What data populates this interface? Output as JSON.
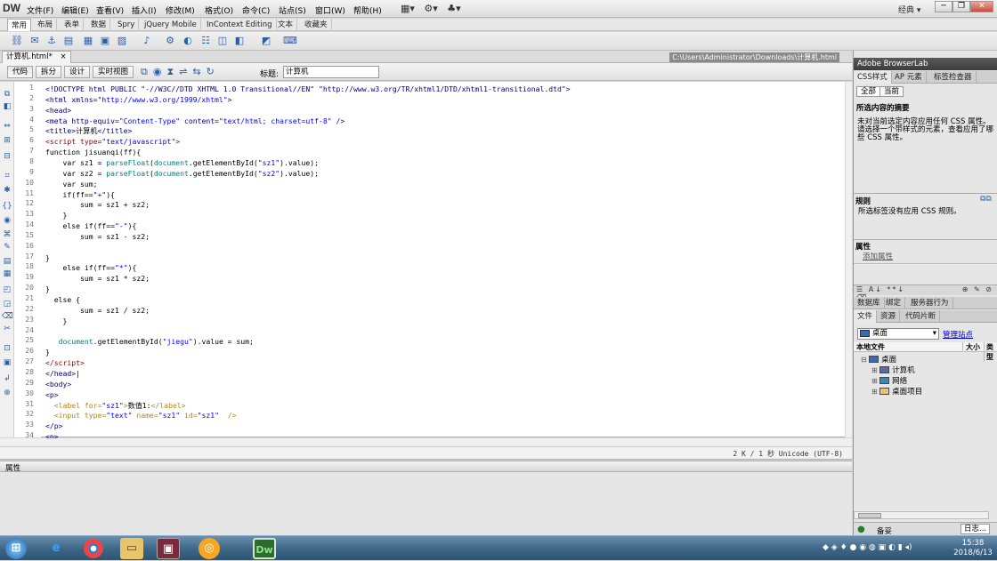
{
  "app": {
    "logo": "DW",
    "menu": [
      "文件(F)",
      "编辑(E)",
      "查看(V)",
      "插入(I)",
      "修改(M)",
      "格式(O)",
      "命令(C)",
      "站点(S)",
      "窗口(W)",
      "帮助(H)"
    ],
    "workspace": "经典",
    "window_buttons": [
      "─",
      "❐",
      "✕"
    ]
  },
  "insert_tabs": [
    "常用",
    "布局",
    "表单",
    "数据",
    "Spry",
    "jQuery Mobile",
    "InContext Editing",
    "文本",
    "收藏夹"
  ],
  "insert_icons": [
    "link-icon",
    "email-icon",
    "anchor-icon",
    "hr-icon",
    "table-icon",
    "div-icon",
    "image-icon",
    "media-icon",
    "date-icon",
    "server-icon",
    "comment-icon",
    "head-icon",
    "script-icon",
    "template-icon",
    "tag-chooser-icon"
  ],
  "document": {
    "tab": "计算机.html*",
    "close_glyph": "×",
    "path": "C:\\Users\\Administrator\\Downloads\\计算机.html"
  },
  "doc_toolbar": {
    "buttons": [
      "代码",
      "拆分",
      "设计",
      "实时视图"
    ],
    "title_label": "标题:",
    "title_value": "计算机"
  },
  "code_lines": [
    {
      "n": "1",
      "html": "<span class=\"tag\">&lt;!DOCTYPE html PUBLIC \"-//W3C//DTD XHTML 1.0 Transitional//EN\" \"http://www.w3.org/TR/xhtml1/DTD/xhtml1-transitional.dtd\"&gt;</span>"
    },
    {
      "n": "2",
      "html": "<span class=\"tag\">&lt;html xmlns=</span><span class=\"str\">\"http://www.w3.org/1999/xhtml\"</span><span class=\"tag\">&gt;</span>"
    },
    {
      "n": "3",
      "html": "<span class=\"tag\">&lt;head&gt;</span>"
    },
    {
      "n": "4",
      "html": "<span class=\"tag\">&lt;meta http-equiv=</span><span class=\"str\">\"Content-Type\"</span><span class=\"tag\"> content=</span><span class=\"str\">\"text/html; charset=utf-8\"</span><span class=\"tag\"> /&gt;</span>"
    },
    {
      "n": "5",
      "html": "<span class=\"tag\">&lt;title&gt;</span>计算机<span class=\"tag\">&lt;/title&gt;</span>"
    },
    {
      "n": "6",
      "html": "<span style=\"color:#8b0000\">&lt;script type=</span><span class=\"str\">\"text/javascript\"</span><span style=\"color:#8b0000\">&gt;</span>"
    },
    {
      "n": "7",
      "html": "function jisuanqi(ff){"
    },
    {
      "n": "8",
      "html": "    var sz1 = <span class=\"fn\">parseFloat</span>(<span class=\"fn\">document</span>.getElementById(<span class=\"str\">\"sz1\"</span>).value);"
    },
    {
      "n": "9",
      "html": "    var sz2 = <span class=\"fn\">parseFloat</span>(<span class=\"fn\">document</span>.getElementById(<span class=\"str\">\"sz2\"</span>).value);"
    },
    {
      "n": "10",
      "html": "    var sum;"
    },
    {
      "n": "11",
      "html": "    if(ff==<span class=\"str\">\"+\"</span>){"
    },
    {
      "n": "12",
      "html": "        sum = sz1 + sz2;"
    },
    {
      "n": "13",
      "html": "    }"
    },
    {
      "n": "14",
      "html": "    else if(ff==<span class=\"str\">\"-\"</span>){"
    },
    {
      "n": "15",
      "html": "        sum = sz1 - sz2;"
    },
    {
      "n": "16",
      "html": ""
    },
    {
      "n": "17",
      "html": "}"
    },
    {
      "n": "18",
      "html": "    else if(ff==<span class=\"str\">\"*\"</span>){"
    },
    {
      "n": "19",
      "html": "        sum = sz1 * sz2;"
    },
    {
      "n": "20",
      "html": "}"
    },
    {
      "n": "21",
      "html": "  else {"
    },
    {
      "n": "22",
      "html": "        sum = sz1 / sz2;"
    },
    {
      "n": "23",
      "html": "    }"
    },
    {
      "n": "24",
      "html": ""
    },
    {
      "n": "25",
      "html": "   <span class=\"fn\">document</span>.getElementById(<span class=\"str\">\"jiegu\"</span>).value = sum;"
    },
    {
      "n": "26",
      "html": "}"
    },
    {
      "n": "27",
      "html": "<span style=\"color:#8b0000\">&lt;/script&gt;</span>"
    },
    {
      "n": "28",
      "html": "<span class=\"tag\">&lt;/head&gt;</span>|"
    },
    {
      "n": "29",
      "html": "<span class=\"tag\">&lt;body&gt;</span>"
    },
    {
      "n": "30",
      "html": "<span class=\"tag\">&lt;p&gt;</span>"
    },
    {
      "n": "31",
      "html": "  <span style=\"color:#b8860b\">&lt;label for=</span><span class=\"str\">\"sz1\"</span><span style=\"color:#b8860b\">&gt;</span>数值1:<span style=\"color:#b8860b\">&lt;/label&gt;</span>"
    },
    {
      "n": "32",
      "html": "  <span style=\"color:#b8860b\">&lt;input type=</span><span class=\"str\">\"text\"</span><span style=\"color:#b8860b\"> name=</span><span class=\"str\">\"sz1\"</span><span style=\"color:#b8860b\"> id=</span><span class=\"str\">\"sz1\"</span><span style=\"color:#b8860b\">  /&gt;</span>"
    },
    {
      "n": "33",
      "html": "<span class=\"tag\">&lt;/p&gt;</span>"
    },
    {
      "n": "34",
      "html": "<span class=\"tag\">&lt;p&gt;</span>"
    }
  ],
  "status": "2 K / 1 秒 Unicode (UTF-8)",
  "properties_title": "属性",
  "right_panel": {
    "browserlab": "Adobe BrowserLab",
    "css_tabs": [
      "CSS样式",
      "AP 元素",
      "标签检查器"
    ],
    "mode_buttons": [
      "全部",
      "当前"
    ],
    "summary_title": "所选内容的摘要",
    "summary_text": "未对当前选定内容应用任何 CSS 属性。请选择一个带样式的元素，查看应用了哪些 CSS 属性。",
    "rules_title": "规则",
    "rules_text": "所选标签没有应用 CSS 规则。",
    "props_title": "属性",
    "add_prop": "添加属性",
    "db_tabs": [
      "数据库",
      "绑定",
      "服务器行为"
    ],
    "file_tabs": [
      "文件",
      "资源",
      "代码片断"
    ],
    "site": "桌面",
    "manage": "管理站点",
    "file_headers": [
      "本地文件",
      "大小",
      "类型"
    ],
    "tree": [
      {
        "label": "桌面",
        "icon": "desktop-icon"
      },
      {
        "label": "计算机",
        "icon": "computer-icon"
      },
      {
        "label": "网络",
        "icon": "network-icon"
      },
      {
        "label": "桌面项目",
        "icon": "folder-icon"
      }
    ],
    "footer_label": "备妥",
    "log_button": "日志..."
  },
  "taskbar": {
    "time": "15:38",
    "date": "2018/6/13",
    "apps": [
      "start-orb-icon",
      "ie-icon",
      "chrome-icon",
      "explorer-icon",
      "app-icon",
      "media-icon",
      "dreamweaver-icon"
    ]
  }
}
